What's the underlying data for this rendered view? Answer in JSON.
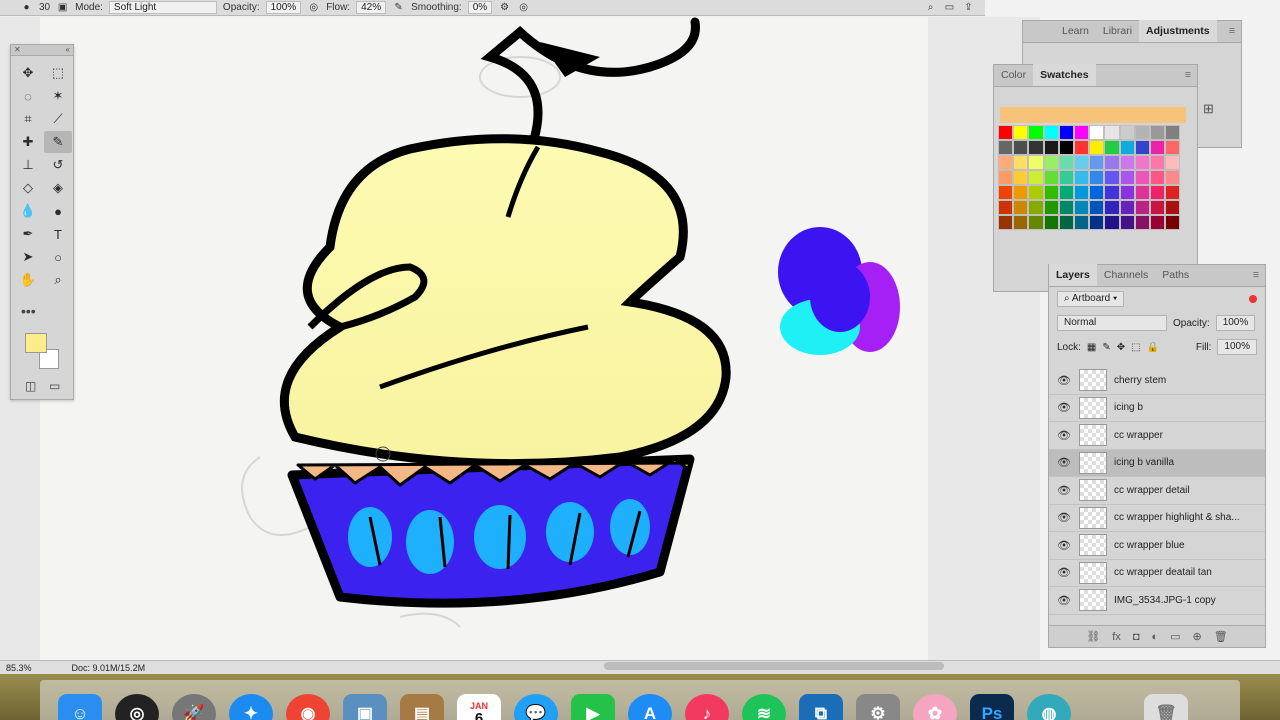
{
  "options_bar": {
    "brush_size": "30",
    "mode_label": "Mode:",
    "mode_value": "Soft Light",
    "opacity_label": "Opacity:",
    "opacity_value": "100%",
    "flow_label": "Flow:",
    "flow_value": "42%",
    "smoothing_label": "Smoothing:",
    "smoothing_value": "0%"
  },
  "top_panel": {
    "tabs": [
      "Learn",
      "Librari",
      "Adjustments"
    ],
    "active": "Adjustments"
  },
  "color_panel": {
    "tabs": [
      "Color",
      "Swatches"
    ],
    "active": "Swatches",
    "swatch_rows": [
      [
        "#ff0000",
        "#ffff00",
        "#00ff00",
        "#00ffff",
        "#0000ff",
        "#ff00ff",
        "#ffffff",
        "#e6e6e6",
        "#cccccc",
        "#b3b3b3",
        "#999999",
        "#808080"
      ],
      [
        "#666666",
        "#4d4d4d",
        "#333333",
        "#1a1a1a",
        "#000000",
        "#ff3333",
        "#ffee00",
        "#22cc44",
        "#11aadd",
        "#3344cc",
        "#ee22aa",
        "#ff6666"
      ],
      [
        "#ffaa77",
        "#ffdd66",
        "#eeff66",
        "#99ee66",
        "#66ddaa",
        "#66ccee",
        "#6699ee",
        "#9977ee",
        "#cc77ee",
        "#ee77cc",
        "#ff77aa",
        "#ffbbbb"
      ],
      [
        "#ff9966",
        "#ffcc33",
        "#ccee33",
        "#66dd33",
        "#33cc99",
        "#33bbee",
        "#3388ee",
        "#6655ee",
        "#aa55ee",
        "#ee55bb",
        "#ff5588",
        "#ff8888"
      ],
      [
        "#ee4400",
        "#ee9900",
        "#aacc00",
        "#33bb00",
        "#00aa77",
        "#0099dd",
        "#0066dd",
        "#4433dd",
        "#8833dd",
        "#dd3399",
        "#ee2266",
        "#dd2222"
      ],
      [
        "#cc3300",
        "#cc8800",
        "#88aa00",
        "#229900",
        "#008866",
        "#0088bb",
        "#0055bb",
        "#3322bb",
        "#6622bb",
        "#bb2288",
        "#cc1144",
        "#aa1111"
      ],
      [
        "#993300",
        "#996600",
        "#668800",
        "#117700",
        "#006644",
        "#006688",
        "#003388",
        "#221188",
        "#441188",
        "#881166",
        "#990033",
        "#770000"
      ]
    ]
  },
  "layers_panel": {
    "tabs": [
      "Layers",
      "Channels",
      "Paths"
    ],
    "active": "Layers",
    "artboard_label": "Artboard",
    "blend_mode": "Normal",
    "opacity_label": "Opacity:",
    "opacity_value": "100%",
    "lock_label": "Lock:",
    "fill_label": "Fill:",
    "fill_value": "100%",
    "layers": [
      {
        "name": "cherry stem"
      },
      {
        "name": "icing b"
      },
      {
        "name": "cc wrapper"
      },
      {
        "name": "icing b vanilla",
        "selected": true
      },
      {
        "name": "cc wrapper detail"
      },
      {
        "name": "cc  wrapper highlight & sha..."
      },
      {
        "name": "cc wrapper blue"
      },
      {
        "name": "cc wrapper deatail tan"
      },
      {
        "name": "IMG_3534.JPG-1 copy"
      }
    ]
  },
  "status_bar": {
    "zoom": "85.3%",
    "doc_info": "Doc: 9.01M/15.2M"
  },
  "colors": {
    "foreground": "#fbee8a",
    "background": "#ffffff",
    "icing": "#fbf7a0",
    "wrapper": "#3b22ee"
  },
  "dock": {
    "icons": [
      "finder-icon",
      "siri-icon",
      "launchpad-icon",
      "safari-icon",
      "chrome-icon",
      "preview-icon",
      "notes-icon",
      "calendar-icon",
      "messages-icon",
      "facetime-icon",
      "appstore-icon",
      "itunes-icon",
      "spotify-icon",
      "app-icon",
      "system-preferences-icon",
      "photos-icon",
      "photoshop-icon",
      "browser-icon",
      "trash-icon"
    ],
    "calendar_month": "JAN",
    "calendar_day": "6",
    "photoshop_label": "Ps"
  }
}
